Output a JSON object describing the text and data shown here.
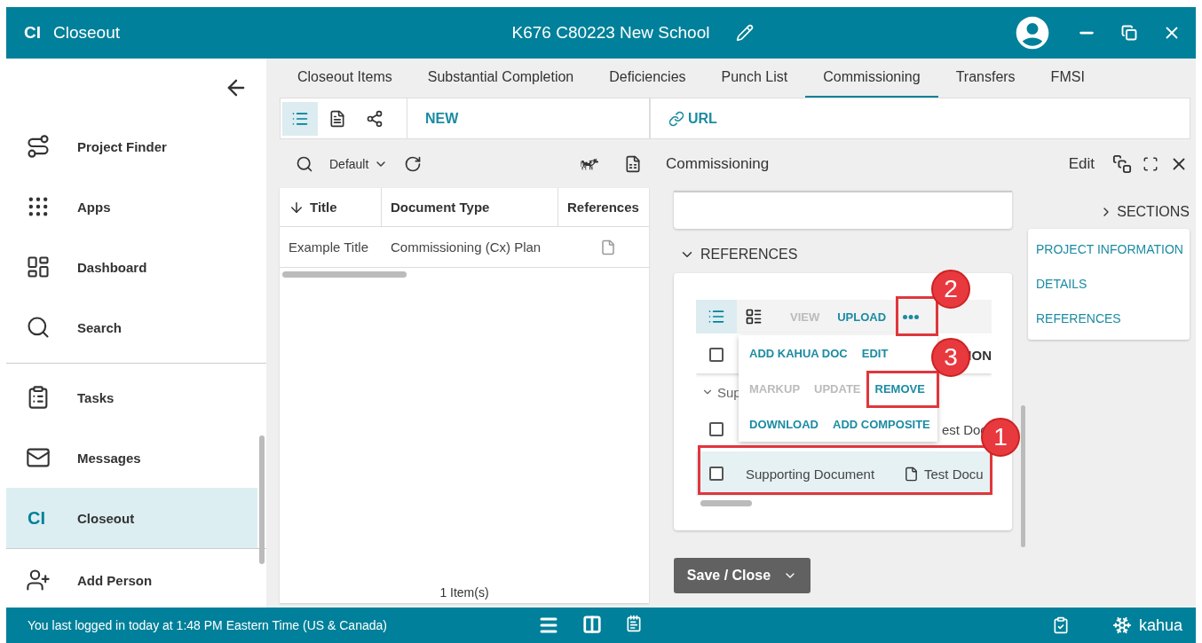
{
  "header": {
    "logo": "CI",
    "app_name": "Closeout",
    "project_title": "K676 C80223 New School"
  },
  "sidebar": {
    "groups": [
      {
        "items": [
          {
            "label": "Project Finder",
            "selected": false
          },
          {
            "label": "Apps",
            "selected": false
          },
          {
            "label": "Dashboard",
            "selected": false
          },
          {
            "label": "Search",
            "selected": false
          }
        ]
      },
      {
        "items": [
          {
            "label": "Tasks",
            "selected": false
          },
          {
            "label": "Messages",
            "selected": false
          },
          {
            "label": "Closeout",
            "selected": true,
            "icon_text": "CI"
          }
        ]
      },
      {
        "items": [
          {
            "label": "Add Person",
            "selected": false
          }
        ]
      }
    ]
  },
  "tabs": [
    {
      "label": "Closeout Items",
      "selected": false
    },
    {
      "label": "Substantial Completion",
      "selected": false
    },
    {
      "label": "Deficiencies",
      "selected": false
    },
    {
      "label": "Punch List",
      "selected": false
    },
    {
      "label": "Commissioning",
      "selected": true
    },
    {
      "label": "Transfers",
      "selected": false
    },
    {
      "label": "FMSI",
      "selected": false
    }
  ],
  "main_toolbar": {
    "view_buttons": [
      {
        "selected": true
      },
      {
        "selected": false
      },
      {
        "selected": false
      }
    ],
    "new_label": "NEW",
    "url_label": "URL"
  },
  "list": {
    "view": "Default",
    "columns": [
      {
        "label": "Title",
        "sorted": true
      },
      {
        "label": "Document Type",
        "sorted": false
      },
      {
        "label": "References",
        "sorted": false
      }
    ],
    "rows": [
      {
        "title": "Example Title",
        "document_type": "Commissioning (Cx) Plan"
      }
    ],
    "footer": "1 Item(s)"
  },
  "detail": {
    "title": "Commissioning",
    "edit_label": "Edit",
    "sections": {
      "label": "SECTIONS",
      "expanded": false,
      "links": [
        "PROJECT INFORMATION",
        "DETAILS",
        "REFERENCES"
      ]
    },
    "references": {
      "label": "REFERENCES",
      "expanded": true,
      "view_buttons": [
        {
          "selected": true
        },
        {
          "selected": false
        }
      ],
      "actions": [
        {
          "label": "VIEW",
          "disabled": true
        },
        {
          "label": "UPLOAD",
          "disabled": false
        }
      ],
      "menu": [
        [
          {
            "label": "ADD KAHUA DOC",
            "disabled": false
          },
          {
            "label": "EDIT",
            "disabled": false
          }
        ],
        [
          {
            "label": "MARKUP",
            "disabled": true
          },
          {
            "label": "UPDATE",
            "disabled": true
          },
          {
            "label": "REMOVE",
            "disabled": false
          }
        ],
        [
          {
            "label": "DOWNLOAD",
            "disabled": false
          },
          {
            "label": "ADD COMPOSITE",
            "disabled": false
          }
        ]
      ],
      "header_checked": false,
      "header_partial": "ION",
      "group_label": "Sup",
      "rows": [
        {
          "kind": "covered",
          "checked": false,
          "selected": false,
          "file": "est Doc"
        },
        {
          "kind": "full",
          "checked": false,
          "selected": true,
          "name": "Supporting Document",
          "file": "Test Docu"
        }
      ]
    }
  },
  "callouts": [
    {
      "number": "1"
    },
    {
      "number": "2"
    },
    {
      "number": "3"
    }
  ],
  "save_button": {
    "label": "Save / Close"
  },
  "status_bar": {
    "message": "You last logged in today at 1:48 PM Eastern Time (US & Canada)",
    "brand": "kahua"
  }
}
